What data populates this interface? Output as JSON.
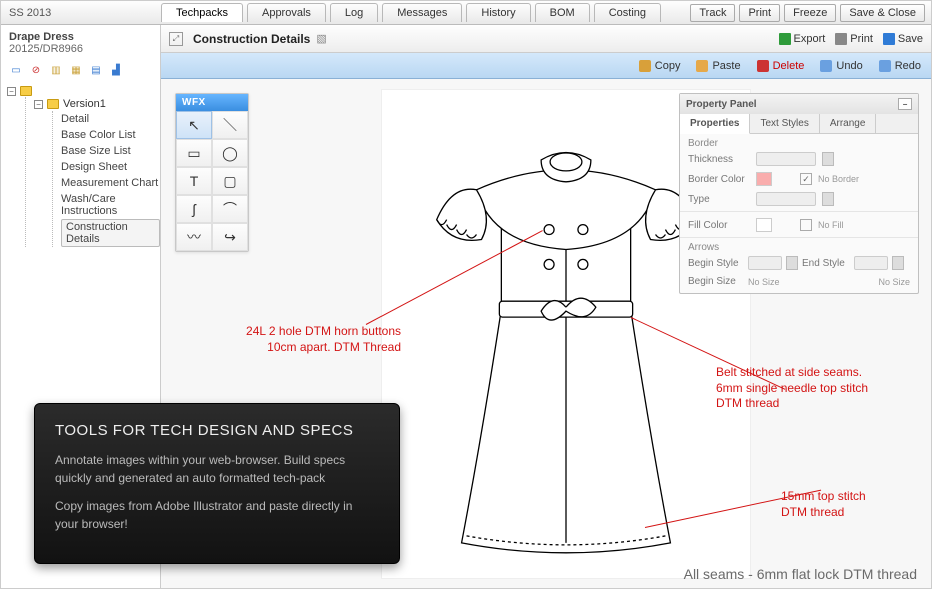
{
  "season": "SS 2013",
  "tabs": [
    "Techpacks",
    "Approvals",
    "Log",
    "Messages",
    "History",
    "BOM",
    "Costing"
  ],
  "active_tab": 0,
  "top_buttons": [
    "Track",
    "Print",
    "Freeze",
    "Save & Close"
  ],
  "sidebar": {
    "product_name": "Drape Dress",
    "product_code": "20125/DR8966",
    "version_label": "Version1",
    "items": [
      "Detail",
      "Base Color List",
      "Base Size List",
      "Design Sheet",
      "Measurement Chart",
      "Wash/Care Instructions",
      "Construction Details"
    ],
    "active_item": 6
  },
  "content_header": {
    "title": "Construction Details",
    "actions": {
      "export": "Export",
      "print": "Print",
      "save": "Save"
    }
  },
  "edit_toolbar": {
    "copy": "Copy",
    "paste": "Paste",
    "delete": "Delete",
    "undo": "Undo",
    "redo": "Redo"
  },
  "palette_title": "WFX",
  "property_panel": {
    "title": "Property Panel",
    "tabs": [
      "Properties",
      "Text Styles",
      "Arrange"
    ],
    "active_tab": 0,
    "border_section": "Border",
    "thickness_label": "Thickness",
    "border_color_label": "Border Color",
    "no_border_label": "No Border",
    "type_label": "Type",
    "fill_section": "Fill Color",
    "no_fill_label": "No Fill",
    "arrows_section": "Arrows",
    "begin_style_label": "Begin Style",
    "end_style_label": "End Style",
    "begin_size_label": "Begin Size",
    "no_size_label": "No Size"
  },
  "annotations": {
    "buttons_l1": "24L 2 hole DTM horn buttons",
    "buttons_l2": "10cm apart. DTM Thread",
    "belt_l1": "Belt stitched at side seams.",
    "belt_l2": "6mm single needle top stitch",
    "belt_l3": "DTM thread",
    "hem_l1": "15mm top stitch",
    "hem_l2": "DTM thread"
  },
  "footer_note": "All seams - 6mm flat lock DTM thread",
  "overlay": {
    "heading": "TOOLS FOR TECH DESIGN AND SPECS",
    "p1": "Annotate images within your web-browser. Build specs quickly and generated an auto formatted tech-pack",
    "p2": "Copy images from Adobe Illustrator and paste directly in your browser!"
  }
}
